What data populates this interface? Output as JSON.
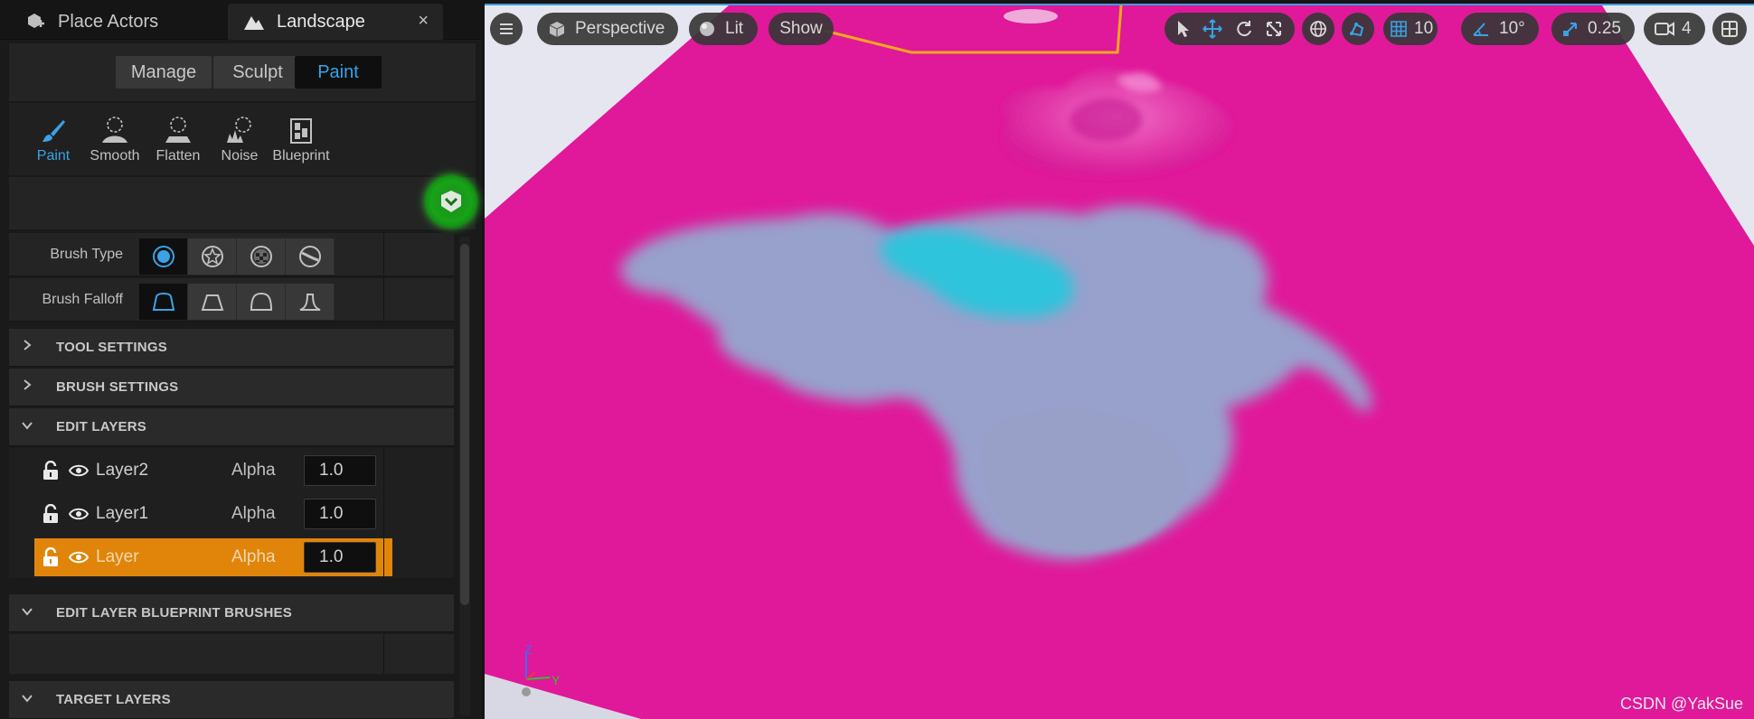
{
  "tabs": {
    "place_actors": "Place Actors",
    "landscape": "Landscape",
    "close": "×"
  },
  "modes": {
    "manage": "Manage",
    "sculpt": "Sculpt",
    "paint": "Paint"
  },
  "tools": [
    {
      "label": "Paint",
      "icon": "paint-brush-icon"
    },
    {
      "label": "Smooth",
      "icon": "smooth-icon"
    },
    {
      "label": "Flatten",
      "icon": "flatten-icon"
    },
    {
      "label": "Noise",
      "icon": "noise-icon"
    },
    {
      "label": "Blueprint",
      "icon": "blueprint-icon"
    }
  ],
  "properties": {
    "brush_type": "Brush Type",
    "brush_falloff": "Brush Falloff"
  },
  "sections": {
    "tool_settings": "TOOL SETTINGS",
    "brush_settings": "BRUSH SETTINGS",
    "edit_layers": "EDIT LAYERS",
    "edit_layer_blueprint_brushes": "EDIT LAYER BLUEPRINT BRUSHES",
    "target_layers": "TARGET LAYERS"
  },
  "layers": [
    {
      "name": "Layer2",
      "alpha_label": "Alpha",
      "alpha": "1.0",
      "selected": false
    },
    {
      "name": "Layer1",
      "alpha_label": "Alpha",
      "alpha": "1.0",
      "selected": false
    },
    {
      "name": "Layer",
      "alpha_label": "Alpha",
      "alpha": "1.0",
      "selected": true
    }
  ],
  "viewport": {
    "perspective": "Perspective",
    "lit": "Lit",
    "show": "Show",
    "grid_snap": "10",
    "rotation_snap": "10°",
    "scale_snap": "0.25",
    "camera_speed": "4",
    "axis_z": "Z",
    "axis_y": "Y",
    "watermark": "CSDN @YakSue"
  },
  "colors": {
    "accent": "#38a3e6",
    "selected_layer": "#e0850a",
    "landscape_magenta": "#e0189a",
    "paint_grey": "#9aa2c8",
    "paint_cyan": "#2ec4dc"
  }
}
